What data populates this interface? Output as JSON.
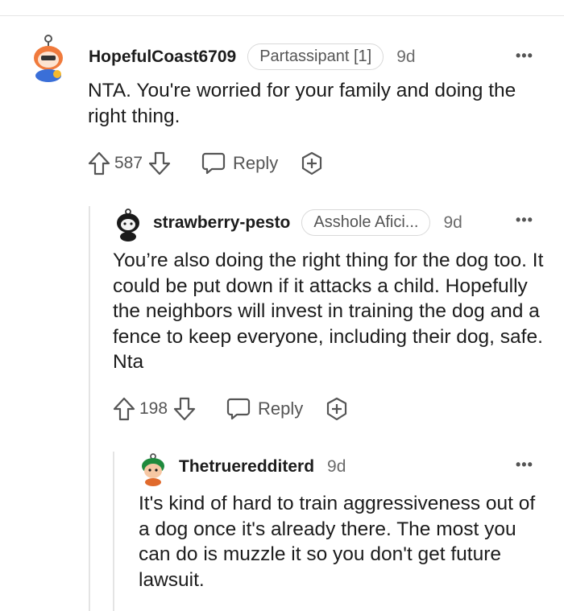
{
  "comments": [
    {
      "username": "HopefulCoast6709",
      "flair": "Partassipant [1]",
      "time": "9d",
      "text": "NTA. You're worried for your family and doing the right thing.",
      "votes": "587",
      "reply_label": "Reply",
      "more": "•••",
      "avatar_icon": "snoo-avatar-icon"
    },
    {
      "username": "strawberry-pesto",
      "flair": "Asshole Afici...",
      "time": "9d",
      "text": "You’re also doing the right thing for the dog too. It could be put down if it attacks a child. Hopefully the neighbors will invest in training the dog and a fence to keep everyone, including their dog, safe. Nta",
      "votes": "198",
      "reply_label": "Reply",
      "more": "•••",
      "avatar_icon": "snoo-avatar-icon"
    },
    {
      "username": "Thetrueredditerd",
      "time": "9d",
      "text": "It's kind of hard to train aggressiveness out of a dog once it's already there. The most you can do is muzzle it so you don't get future lawsuit.",
      "more": "•••",
      "avatar_icon": "snoo-avatar-icon"
    }
  ],
  "colors": {
    "text": "#1c1c1c",
    "muted": "#555555",
    "thread_line": "#e4e4e4"
  }
}
